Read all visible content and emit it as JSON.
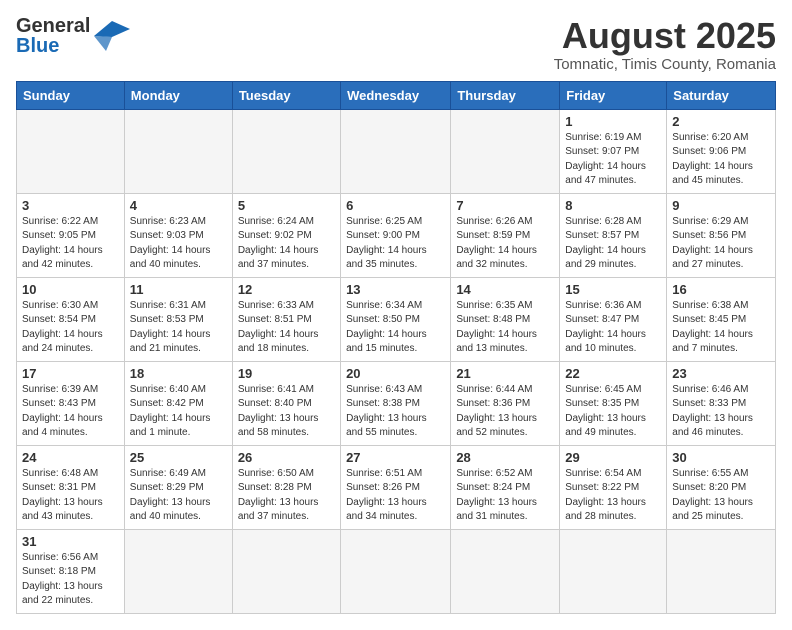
{
  "header": {
    "logo_general": "General",
    "logo_blue": "Blue",
    "title": "August 2025",
    "subtitle": "Tomnatic, Timis County, Romania"
  },
  "weekdays": [
    "Sunday",
    "Monday",
    "Tuesday",
    "Wednesday",
    "Thursday",
    "Friday",
    "Saturday"
  ],
  "weeks": [
    [
      {
        "day": "",
        "info": ""
      },
      {
        "day": "",
        "info": ""
      },
      {
        "day": "",
        "info": ""
      },
      {
        "day": "",
        "info": ""
      },
      {
        "day": "",
        "info": ""
      },
      {
        "day": "1",
        "info": "Sunrise: 6:19 AM\nSunset: 9:07 PM\nDaylight: 14 hours and 47 minutes."
      },
      {
        "day": "2",
        "info": "Sunrise: 6:20 AM\nSunset: 9:06 PM\nDaylight: 14 hours and 45 minutes."
      }
    ],
    [
      {
        "day": "3",
        "info": "Sunrise: 6:22 AM\nSunset: 9:05 PM\nDaylight: 14 hours and 42 minutes."
      },
      {
        "day": "4",
        "info": "Sunrise: 6:23 AM\nSunset: 9:03 PM\nDaylight: 14 hours and 40 minutes."
      },
      {
        "day": "5",
        "info": "Sunrise: 6:24 AM\nSunset: 9:02 PM\nDaylight: 14 hours and 37 minutes."
      },
      {
        "day": "6",
        "info": "Sunrise: 6:25 AM\nSunset: 9:00 PM\nDaylight: 14 hours and 35 minutes."
      },
      {
        "day": "7",
        "info": "Sunrise: 6:26 AM\nSunset: 8:59 PM\nDaylight: 14 hours and 32 minutes."
      },
      {
        "day": "8",
        "info": "Sunrise: 6:28 AM\nSunset: 8:57 PM\nDaylight: 14 hours and 29 minutes."
      },
      {
        "day": "9",
        "info": "Sunrise: 6:29 AM\nSunset: 8:56 PM\nDaylight: 14 hours and 27 minutes."
      }
    ],
    [
      {
        "day": "10",
        "info": "Sunrise: 6:30 AM\nSunset: 8:54 PM\nDaylight: 14 hours and 24 minutes."
      },
      {
        "day": "11",
        "info": "Sunrise: 6:31 AM\nSunset: 8:53 PM\nDaylight: 14 hours and 21 minutes."
      },
      {
        "day": "12",
        "info": "Sunrise: 6:33 AM\nSunset: 8:51 PM\nDaylight: 14 hours and 18 minutes."
      },
      {
        "day": "13",
        "info": "Sunrise: 6:34 AM\nSunset: 8:50 PM\nDaylight: 14 hours and 15 minutes."
      },
      {
        "day": "14",
        "info": "Sunrise: 6:35 AM\nSunset: 8:48 PM\nDaylight: 14 hours and 13 minutes."
      },
      {
        "day": "15",
        "info": "Sunrise: 6:36 AM\nSunset: 8:47 PM\nDaylight: 14 hours and 10 minutes."
      },
      {
        "day": "16",
        "info": "Sunrise: 6:38 AM\nSunset: 8:45 PM\nDaylight: 14 hours and 7 minutes."
      }
    ],
    [
      {
        "day": "17",
        "info": "Sunrise: 6:39 AM\nSunset: 8:43 PM\nDaylight: 14 hours and 4 minutes."
      },
      {
        "day": "18",
        "info": "Sunrise: 6:40 AM\nSunset: 8:42 PM\nDaylight: 14 hours and 1 minute."
      },
      {
        "day": "19",
        "info": "Sunrise: 6:41 AM\nSunset: 8:40 PM\nDaylight: 13 hours and 58 minutes."
      },
      {
        "day": "20",
        "info": "Sunrise: 6:43 AM\nSunset: 8:38 PM\nDaylight: 13 hours and 55 minutes."
      },
      {
        "day": "21",
        "info": "Sunrise: 6:44 AM\nSunset: 8:36 PM\nDaylight: 13 hours and 52 minutes."
      },
      {
        "day": "22",
        "info": "Sunrise: 6:45 AM\nSunset: 8:35 PM\nDaylight: 13 hours and 49 minutes."
      },
      {
        "day": "23",
        "info": "Sunrise: 6:46 AM\nSunset: 8:33 PM\nDaylight: 13 hours and 46 minutes."
      }
    ],
    [
      {
        "day": "24",
        "info": "Sunrise: 6:48 AM\nSunset: 8:31 PM\nDaylight: 13 hours and 43 minutes."
      },
      {
        "day": "25",
        "info": "Sunrise: 6:49 AM\nSunset: 8:29 PM\nDaylight: 13 hours and 40 minutes."
      },
      {
        "day": "26",
        "info": "Sunrise: 6:50 AM\nSunset: 8:28 PM\nDaylight: 13 hours and 37 minutes."
      },
      {
        "day": "27",
        "info": "Sunrise: 6:51 AM\nSunset: 8:26 PM\nDaylight: 13 hours and 34 minutes."
      },
      {
        "day": "28",
        "info": "Sunrise: 6:52 AM\nSunset: 8:24 PM\nDaylight: 13 hours and 31 minutes."
      },
      {
        "day": "29",
        "info": "Sunrise: 6:54 AM\nSunset: 8:22 PM\nDaylight: 13 hours and 28 minutes."
      },
      {
        "day": "30",
        "info": "Sunrise: 6:55 AM\nSunset: 8:20 PM\nDaylight: 13 hours and 25 minutes."
      }
    ],
    [
      {
        "day": "31",
        "info": "Sunrise: 6:56 AM\nSunset: 8:18 PM\nDaylight: 13 hours and 22 minutes."
      },
      {
        "day": "",
        "info": ""
      },
      {
        "day": "",
        "info": ""
      },
      {
        "day": "",
        "info": ""
      },
      {
        "day": "",
        "info": ""
      },
      {
        "day": "",
        "info": ""
      },
      {
        "day": "",
        "info": ""
      }
    ]
  ]
}
